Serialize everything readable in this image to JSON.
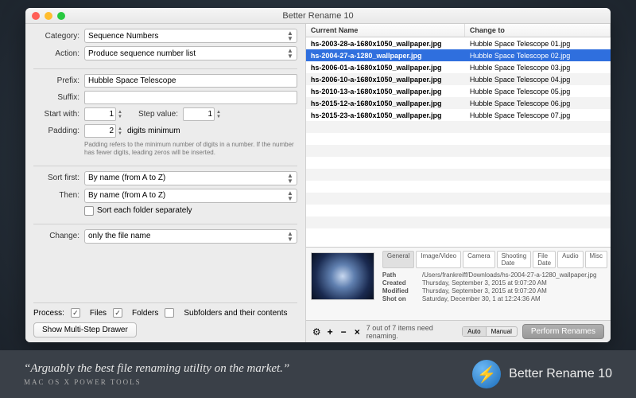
{
  "window": {
    "title": "Better Rename 10"
  },
  "left": {
    "category_label": "Category:",
    "category_value": "Sequence Numbers",
    "action_label": "Action:",
    "action_value": "Produce sequence number list",
    "prefix_label": "Prefix:",
    "prefix_value": "Hubble Space Telescope",
    "suffix_label": "Suffix:",
    "suffix_value": "",
    "start_label": "Start with:",
    "start_value": "1",
    "step_label": "Step value:",
    "step_value": "1",
    "padding_label": "Padding:",
    "padding_value": "2",
    "padding_suffix": "digits minimum",
    "padding_help": "Padding refers to the minimum number of digits in a number. If the number has fewer digits, leading zeros will be inserted.",
    "sort1_label": "Sort first:",
    "sort1_value": "By name (from A to Z)",
    "sort2_label": "Then:",
    "sort2_value": "By name (from A to Z)",
    "sort_sep_label": "Sort each folder separately",
    "change_label": "Change:",
    "change_value": "only the file name",
    "process_label": "Process:",
    "process_files": "Files",
    "process_folders": "Folders",
    "process_sub": "Subfolders and their contents",
    "multi_btn": "Show Multi-Step Drawer"
  },
  "table": {
    "col1": "Current Name",
    "col2": "Change to",
    "rows": [
      {
        "cur": "hs-2003-28-a-1680x1050_wallpaper.jpg",
        "to": "Hubble Space Telescope 01.jpg",
        "sel": false
      },
      {
        "cur": "hs-2004-27-a-1280_wallpaper.jpg",
        "to": "Hubble Space Telescope 02.jpg",
        "sel": true
      },
      {
        "cur": "hs-2006-01-a-1680x1050_wallpaper.jpg",
        "to": "Hubble Space Telescope 03.jpg",
        "sel": false
      },
      {
        "cur": "hs-2006-10-a-1680x1050_wallpaper.jpg",
        "to": "Hubble Space Telescope 04.jpg",
        "sel": false
      },
      {
        "cur": "hs-2010-13-a-1680x1050_wallpaper.jpg",
        "to": "Hubble Space Telescope 05.jpg",
        "sel": false
      },
      {
        "cur": "hs-2015-12-a-1680x1050_wallpaper.jpg",
        "to": "Hubble Space Telescope 06.jpg",
        "sel": false
      },
      {
        "cur": "hs-2015-23-a-1680x1050_wallpaper.jpg",
        "to": "Hubble Space Telescope 07.jpg",
        "sel": false
      }
    ]
  },
  "meta": {
    "tabs": [
      "General",
      "Image/Video",
      "Camera",
      "Shooting Date",
      "File Date",
      "Audio",
      "Misc"
    ],
    "active_tab": 0,
    "path_k": "Path",
    "path_v": "/Users/frankreiff/Downloads/hs-2004-27-a-1280_wallpaper.jpg",
    "created_k": "Created",
    "created_v": "Thursday, September 3, 2015 at 9:07:20 AM",
    "modified_k": "Modified",
    "modified_v": "Thursday, September 3, 2015 at 9:07:20 AM",
    "shot_k": "Shot on",
    "shot_v": "Saturday, December 30, 1 at 12:24:36 AM"
  },
  "bottom": {
    "status": "7 out of 7 items need renaming.",
    "auto": "Auto",
    "manual": "Manual",
    "perform": "Perform Renames"
  },
  "footer": {
    "quote": "Arguably the best file renaming utility on  the market.",
    "source": "MAC OS X POWER TOOLS",
    "product": "Better Rename 10",
    "bolt": "⚡"
  }
}
